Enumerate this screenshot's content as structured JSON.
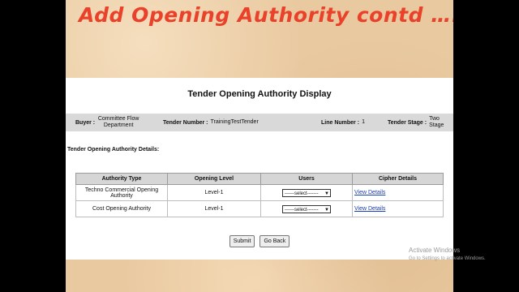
{
  "slide": {
    "title": "Add Opening Authority contd …."
  },
  "page": {
    "title": "Tender Opening Authority Display",
    "info": {
      "buyer_label": "Buyer :",
      "buyer_value": "Committee Flow Department",
      "tender_number_label": "Tender Number :",
      "tender_number_value": "TrainingTestTender",
      "line_number_label": "Line Number :",
      "line_number_value": "1",
      "tender_stage_label": "Tender Stage :",
      "tender_stage_value": "Two Stage"
    },
    "details_label": "Tender Opening Authority Details:",
    "table": {
      "headers": [
        "Authority Type",
        "Opening Level",
        "Users",
        "Cipher Details"
      ],
      "rows": [
        {
          "authority_type": "Techno Commercial Opening Authority",
          "opening_level": "Level-1",
          "users": "------select-------",
          "cipher": "View Details"
        },
        {
          "authority_type": "Cost Opening Authority",
          "opening_level": "Level-1",
          "users": "------select-------",
          "cipher": "View Details"
        }
      ]
    },
    "buttons": {
      "submit": "Submit",
      "go_back": "Go Back"
    }
  },
  "watermark": {
    "line1": "Activate Windows",
    "line2": "Go to Settings to activate Windows."
  },
  "icons": {
    "select_arrow": "chevron-down-icon"
  },
  "colors": {
    "title": "#e9412a",
    "link": "#1a3cb4",
    "info_bar": "#d9d9d9"
  }
}
